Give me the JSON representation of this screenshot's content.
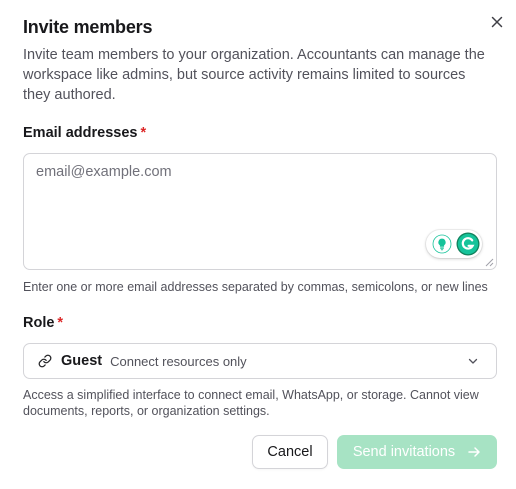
{
  "dialog": {
    "title": "Invite members",
    "description": "Invite team members to your organization. Accountants can manage the workspace like admins, but source activity remains limited to sources they authored."
  },
  "email": {
    "label": "Email addresses",
    "required_marker": "*",
    "placeholder": "email@example.com",
    "hint": "Enter one or more email addresses separated by commas, semicolons, or new lines"
  },
  "role": {
    "label": "Role",
    "required_marker": "*",
    "selected": "Guest",
    "selected_sub": "Connect resources only",
    "hint": "Access a simplified interface to connect email, WhatsApp, or storage. Cannot view documents, reports, or organization settings."
  },
  "actions": {
    "cancel_label": "Cancel",
    "send_label": "Send invitations"
  },
  "colors": {
    "primary_disabled": "#a7e3c4",
    "required": "#dc2626",
    "grammarly": "#15c39a"
  },
  "icons": {
    "close": "close-icon",
    "role": "link-icon",
    "select": "chevron-down-icon",
    "send": "arrow-right-icon",
    "grammarly_tip": "lightbulb-icon",
    "grammarly": "grammarly-icon"
  }
}
